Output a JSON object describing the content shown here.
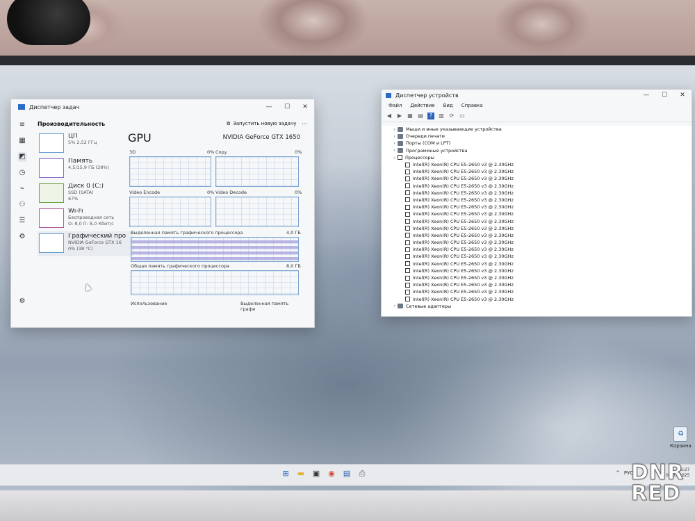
{
  "task_manager": {
    "title": "Диспетчер задач",
    "section": "Производительность",
    "run_task": "Запустить новую задачу",
    "items": [
      {
        "name": "ЦП",
        "line1": "5% 2,52 ГГц",
        "line2": ""
      },
      {
        "name": "Память",
        "line1": "4,5/15,9 ГБ (28%)",
        "line2": ""
      },
      {
        "name": "Диск 0 (C:)",
        "line1": "SSD (SATA)",
        "line2": "67%"
      },
      {
        "name": "Wi-Fi",
        "line1": "Беспроводная сеть",
        "line2": "О: 8,0 П: 8,0 Кбит/с"
      },
      {
        "name": "Графический про",
        "line1": "NVIDIA GeForce GTX 16",
        "line2": "0% (38 °C)"
      }
    ],
    "gpu": {
      "title": "GPU",
      "model": "NVIDIA GeForce GTX 1650",
      "engines": [
        {
          "label": "3D",
          "pct": "0%"
        },
        {
          "label": "Copy",
          "pct": "0%"
        },
        {
          "label": "Video Encode",
          "pct": "0%"
        },
        {
          "label": "Video Decode",
          "pct": "0%"
        }
      ],
      "dedicated_label": "Выделенная память графического процессора",
      "dedicated_max": "4,0 ГБ",
      "shared_label": "Общая память графического процессора",
      "shared_max": "8,0 ГБ",
      "usage_label": "Использование",
      "dedicated_short": "Выделенная память графи"
    }
  },
  "device_manager": {
    "title": "Диспетчер устройств",
    "menu": [
      "Файл",
      "Действие",
      "Вид",
      "Справка"
    ],
    "categories_before": [
      "Мыши и иные указывающие устройства",
      "Очереди печати",
      "Порты (COM и LPT)",
      "Программные устройства"
    ],
    "processors_label": "Процессоры",
    "processor_name": "Intel(R) Xeon(R) CPU E5-2650 v3 @ 2.30GHz",
    "processor_count": 20,
    "category_after": "Сетевые адаптеры"
  },
  "desktop": {
    "recycle_bin": "Корзина"
  },
  "taskbar": {
    "lang": "РУС",
    "time": "16:27",
    "date": "01.05.2025"
  },
  "watermark": {
    "line1": "DNR",
    "line2": "RED"
  }
}
